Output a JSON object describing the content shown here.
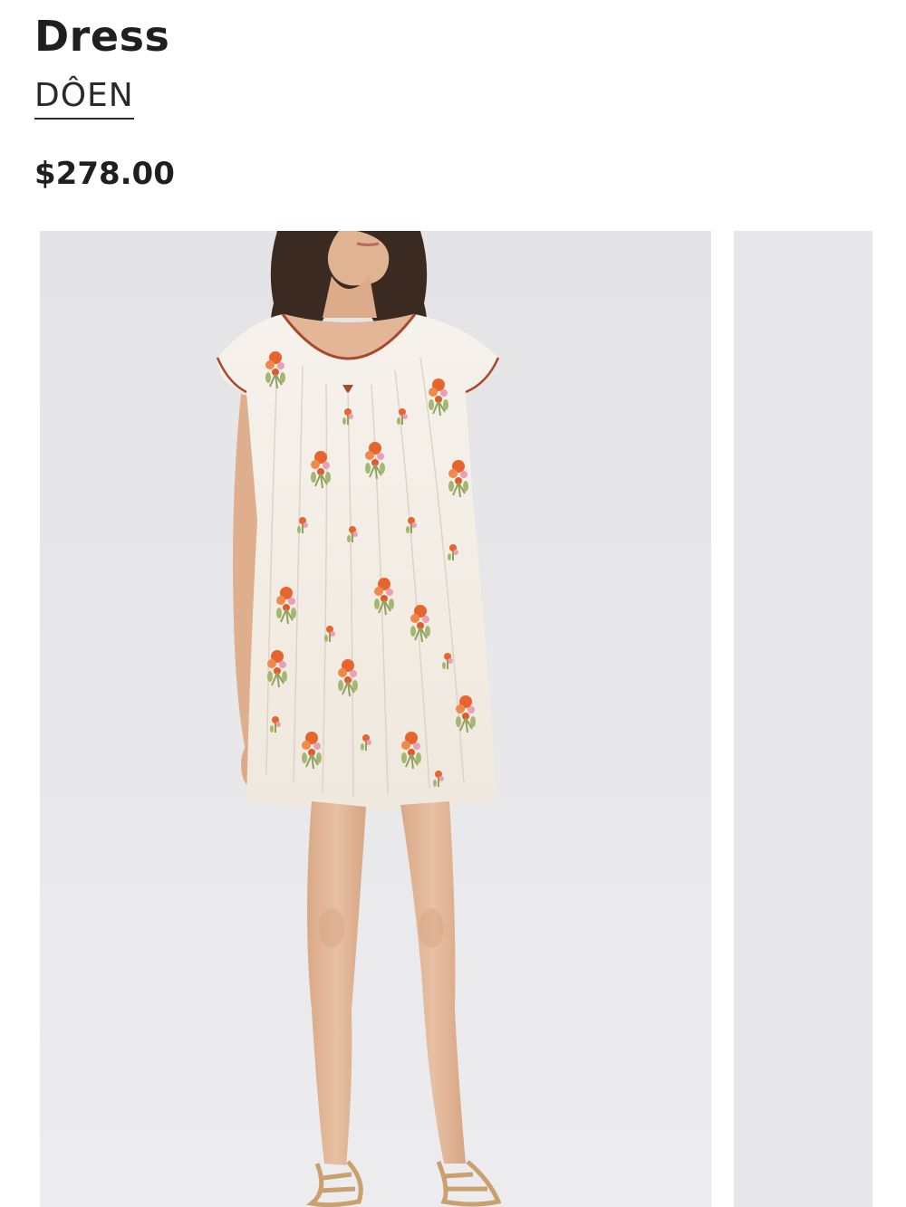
{
  "product": {
    "title": "Dress",
    "brand": "DÔEN",
    "price": "$278.00"
  },
  "gallery": {
    "images": [
      {
        "name": "model-front-view",
        "description_icon": "product-photo"
      },
      {
        "name": "next-image-peek",
        "description_icon": "product-photo"
      }
    ]
  },
  "colors": {
    "background": "#ffffff",
    "photo_backdrop": "#e6e6e8",
    "text": "#1f1f1f",
    "dress_base": "#f4efe8",
    "floral_orange": "#e8642f",
    "floral_green": "#9bb06a",
    "skin": "#e4b99b",
    "hair": "#3a2a22",
    "sandal": "#c9a06e"
  }
}
